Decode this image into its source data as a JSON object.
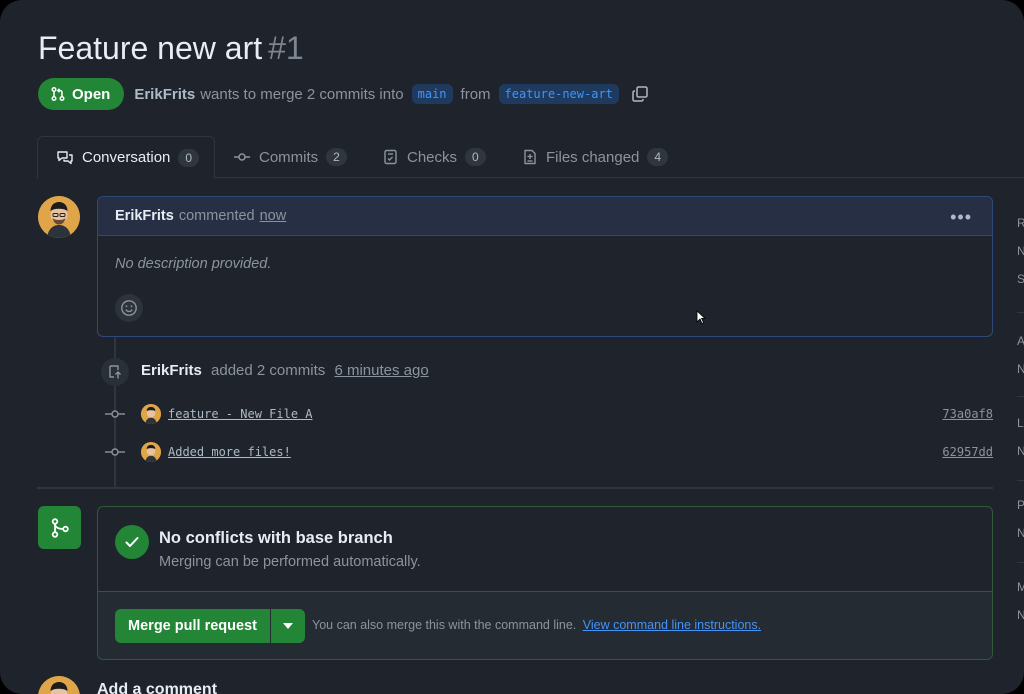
{
  "pr": {
    "title": "Feature new art",
    "number": "#1",
    "status": "Open",
    "author": "ErikFrits",
    "summary": "wants to merge 2 commits into",
    "base_branch": "main",
    "from_word": "from",
    "head_branch": "feature-new-art"
  },
  "tabs": [
    {
      "label": "Conversation",
      "count": "0",
      "icon": "conversation-icon"
    },
    {
      "label": "Commits",
      "count": "2",
      "icon": "commit-icon"
    },
    {
      "label": "Checks",
      "count": "0",
      "icon": "checks-icon"
    },
    {
      "label": "Files changed",
      "count": "4",
      "icon": "file-diff-icon"
    }
  ],
  "comment": {
    "author": "ErikFrits",
    "action": "commented",
    "time": "now",
    "body": "No description provided.",
    "menu_icon": "kebab-horizontal-icon",
    "reaction_icon": "smiley-icon"
  },
  "commits_event": {
    "author": "ErikFrits",
    "action": "added 2 commits",
    "time": "6 minutes ago",
    "icon": "repo-push-icon",
    "commits": [
      {
        "message": "feature - New File A",
        "sha": "73a0af8"
      },
      {
        "message": "Added more files!",
        "sha": "62957dd"
      }
    ]
  },
  "merge": {
    "title": "No conflicts with base branch",
    "subtitle": "Merging can be performed automatically.",
    "button_label": "Merge pull request",
    "hint": "You can also merge this with the command line.",
    "hint_link": "View command line instructions."
  },
  "add_comment": {
    "heading": "Add a comment"
  },
  "sidebar_fragments": [
    "R",
    "N",
    "S",
    "A",
    "N",
    "L",
    "N",
    "P",
    "N",
    "M",
    "N"
  ],
  "colors": {
    "background": "#1f242c",
    "accent_green": "#238636",
    "link_blue": "#4493f8",
    "comment_border": "#2f4a7a"
  }
}
